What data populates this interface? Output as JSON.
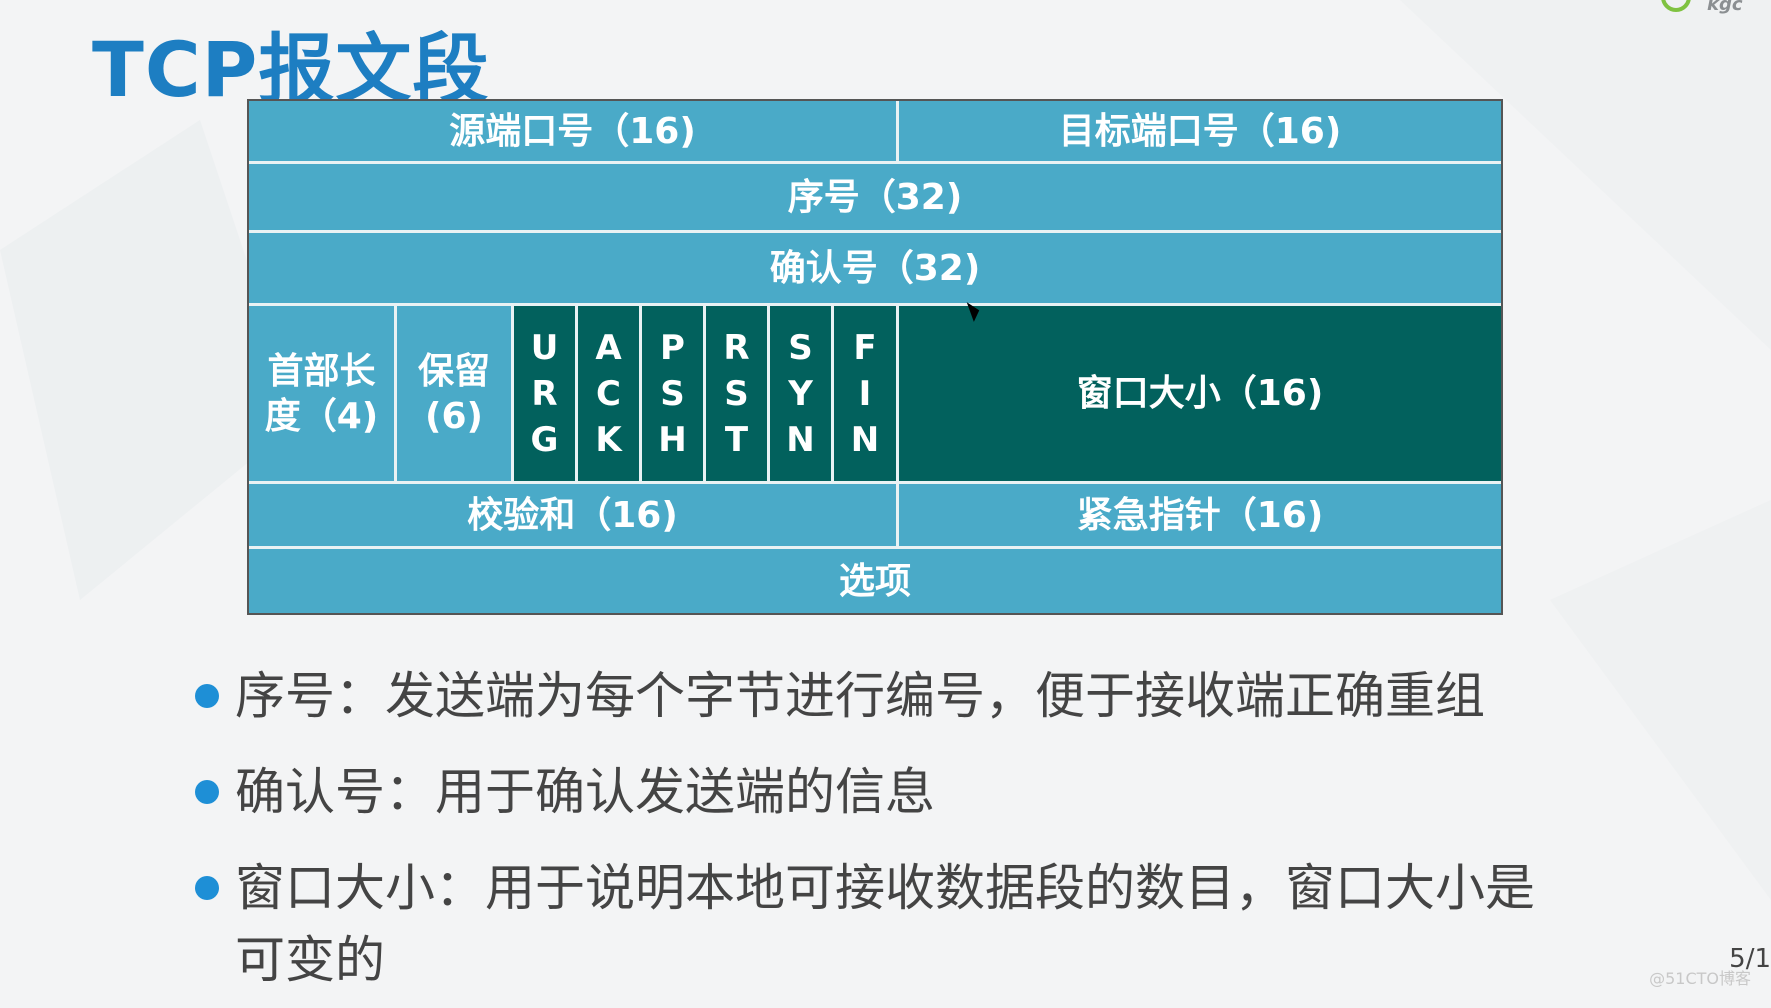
{
  "title": "TCP报文段",
  "logo_text": "kgc",
  "header": {
    "row1": {
      "source_port": "源端口号（16)",
      "dest_port": "目标端口号（16)"
    },
    "seq": "序号（32)",
    "ack": "确认号（32)",
    "header_len_line1": "首部长",
    "header_len_line2": "度（4)",
    "reserved_line1": "保留",
    "reserved_line2": "(6)",
    "flags": [
      {
        "c1": "U",
        "c2": "R",
        "c3": "G"
      },
      {
        "c1": "A",
        "c2": "C",
        "c3": "K"
      },
      {
        "c1": "P",
        "c2": "S",
        "c3": "H"
      },
      {
        "c1": "R",
        "c2": "S",
        "c3": "T"
      },
      {
        "c1": "S",
        "c2": "Y",
        "c3": "N"
      },
      {
        "c1": "F",
        "c2": "I",
        "c3": "N"
      }
    ],
    "window": "窗口大小（16)",
    "checksum": "校验和（16)",
    "urgent": "紧急指针（16)",
    "options": "选项"
  },
  "bullets": [
    "序号：发送端为每个字节进行编号，便于接收端正确重组",
    "确认号：用于确认发送端的信息",
    "窗口大小：用于说明本地可接收数据段的数目，窗口大小是",
    "可变的"
  ],
  "page_number": "5/1",
  "watermark": "@51CTO博客",
  "colors": {
    "title": "#1d7ec2",
    "cell": "#4aaac8",
    "dark": "#02615d",
    "bullet": "#1e8fd6"
  }
}
